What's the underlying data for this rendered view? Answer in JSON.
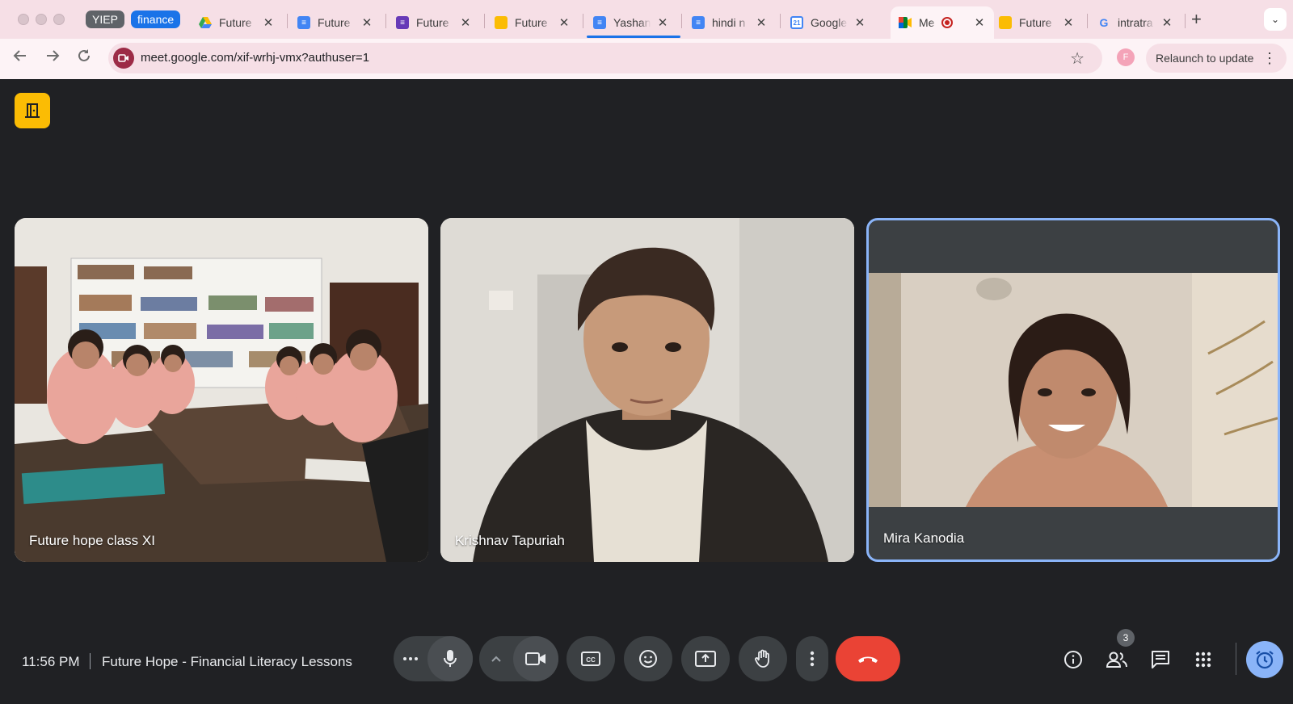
{
  "browser": {
    "groups": [
      {
        "label": "YIEP",
        "color": "#5f6368"
      },
      {
        "label": "finance",
        "color": "#1a73e8"
      }
    ],
    "tabs": [
      {
        "title": "Future",
        "icon": "drive-icon"
      },
      {
        "title": "Future",
        "icon": "docs-icon"
      },
      {
        "title": "Future",
        "icon": "forms-icon"
      },
      {
        "title": "Future",
        "icon": "slides-icon"
      },
      {
        "title": "Yashan",
        "icon": "docs-icon"
      },
      {
        "title": "hindi n",
        "icon": "docs-icon"
      },
      {
        "title": "Google",
        "icon": "calendar-icon"
      },
      {
        "title": "Me",
        "icon": "meet-icon",
        "active": true,
        "recording": true
      },
      {
        "title": "Future",
        "icon": "slides-icon"
      },
      {
        "title": "intratra",
        "icon": "google-icon"
      }
    ],
    "close_glyph": "✕",
    "new_tab_glyph": "+",
    "tab_list_glyph": "⌄",
    "url": "meet.google.com/xif-wrhj-vmx?authuser=1",
    "profile_initial": "F",
    "relaunch_label": "Relaunch to update"
  },
  "meet": {
    "participants": [
      {
        "name": "Future hope class XI"
      },
      {
        "name": "Krishnav Tapuriah"
      },
      {
        "name": "Mira Kanodia",
        "highlighted": true
      }
    ],
    "time": "11:56 PM",
    "meeting_title": "Future Hope - Financial Literacy Lessons",
    "people_count": "3",
    "colors": {
      "end_call": "#ea4335",
      "accent": "#8ab4f8",
      "room_button": "#fbbc04"
    }
  }
}
